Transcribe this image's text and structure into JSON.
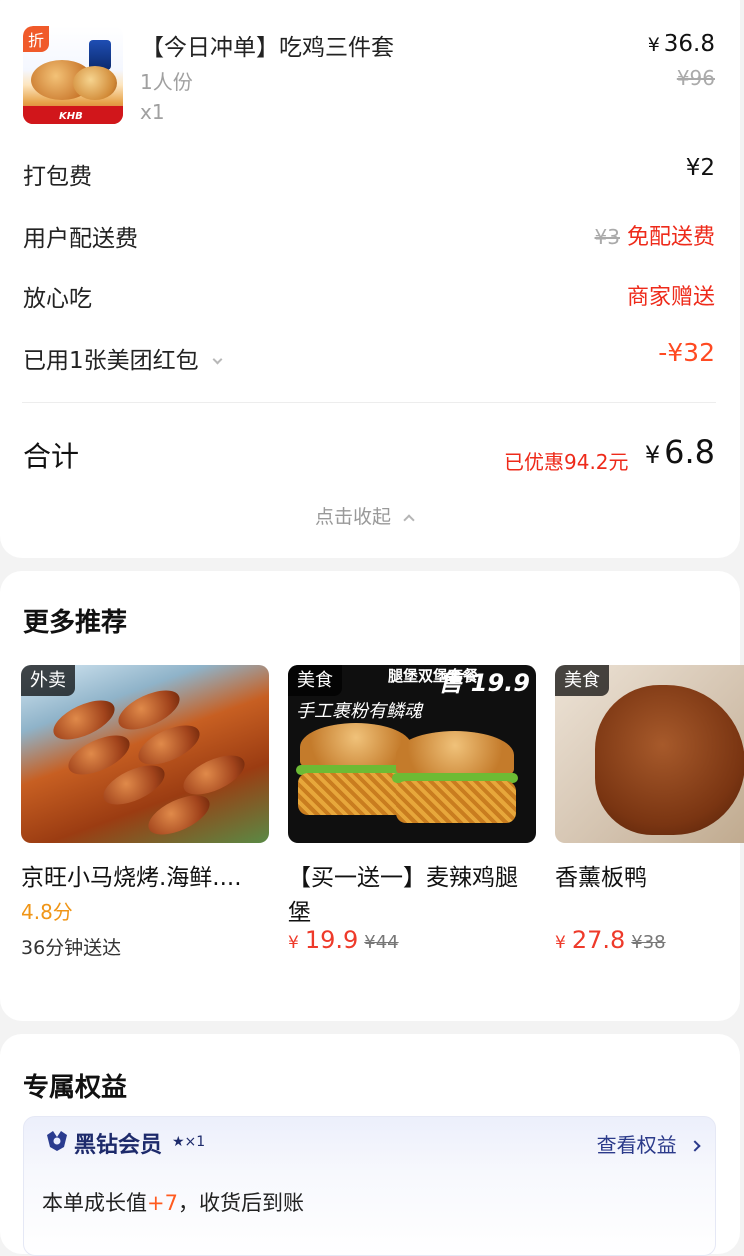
{
  "order": {
    "product": {
      "badge": "折",
      "name": "【今日冲单】吃鸡三件套",
      "spec": "1人份",
      "qty": "x1",
      "price_symbol": "¥",
      "price": "36.8",
      "original_price": "¥96",
      "image_text": "KHB"
    },
    "fees": {
      "packing_label": "打包费",
      "packing_value": "¥2",
      "delivery_label": "用户配送费",
      "delivery_old": "¥3",
      "delivery_free": "免配送费",
      "assured_label": "放心吃",
      "assured_value": "商家赠送",
      "coupon_label": "已用1张美团红包",
      "coupon_value": "-¥32"
    },
    "total": {
      "label": "合计",
      "saved": "已优惠94.2元",
      "symbol": "¥",
      "amount": "6.8"
    },
    "collapse_label": "点击收起"
  },
  "recommend": {
    "title": "更多推荐",
    "items": [
      {
        "tag": "外卖",
        "name": "京旺小马烧烤.海鲜....",
        "rating": "4.8分",
        "eta": "36分钟送达"
      },
      {
        "tag": "美食",
        "name_line1": "【买一送一】麦辣鸡腿",
        "name_line2": "堡",
        "price_symbol": "¥",
        "price": "19.9",
        "old_price": "¥44",
        "banner": "腿堡双堡套餐",
        "banner_price": "售 19.9",
        "slogan": "手工裹粉有鳞魂"
      },
      {
        "tag": "美食",
        "name": "香薰板鸭",
        "price_symbol": "¥",
        "price": "27.8",
        "old_price": "¥38"
      }
    ]
  },
  "benefits": {
    "title": "专属权益",
    "member_name": "黑钻会员",
    "member_star": "★×1",
    "view_label": "查看权益",
    "growth_prefix": "本单成长值",
    "growth_value": "+7",
    "growth_suffix": "，收货后到账"
  },
  "colors": {
    "accent_red": "#ee2a1a",
    "rating_orange": "#f09516",
    "member_navy": "#1d2a6b"
  }
}
